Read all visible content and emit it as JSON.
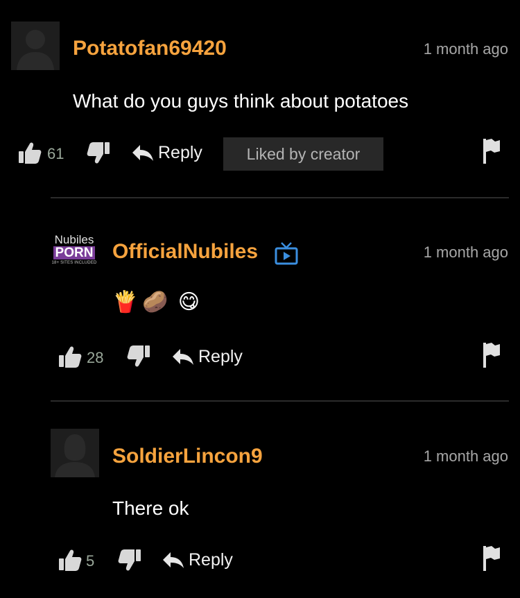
{
  "comments": [
    {
      "username": "Potatofan69420",
      "timestamp": "1 month ago",
      "text": "What do you guys think about potatoes",
      "likes": "61",
      "reply_label": "Reply",
      "badge": "Liked by creator"
    },
    {
      "username": "OfficialNubiles",
      "timestamp": "1 month ago",
      "logo": {
        "top": "Nubiles",
        "middle": "PORN",
        "bottom": "18+ SITES INCLUDED"
      },
      "emojis": [
        "🍟",
        "🥔",
        "😋"
      ],
      "likes": "28",
      "reply_label": "Reply"
    },
    {
      "username": "SoldierLincon9",
      "timestamp": "1 month ago",
      "text": "There ok",
      "likes": "5",
      "reply_label": "Reply"
    }
  ],
  "colors": {
    "username": "#f6a33e",
    "background": "#000000",
    "badge_bg": "#282828",
    "verified": "#3b8fe0"
  }
}
